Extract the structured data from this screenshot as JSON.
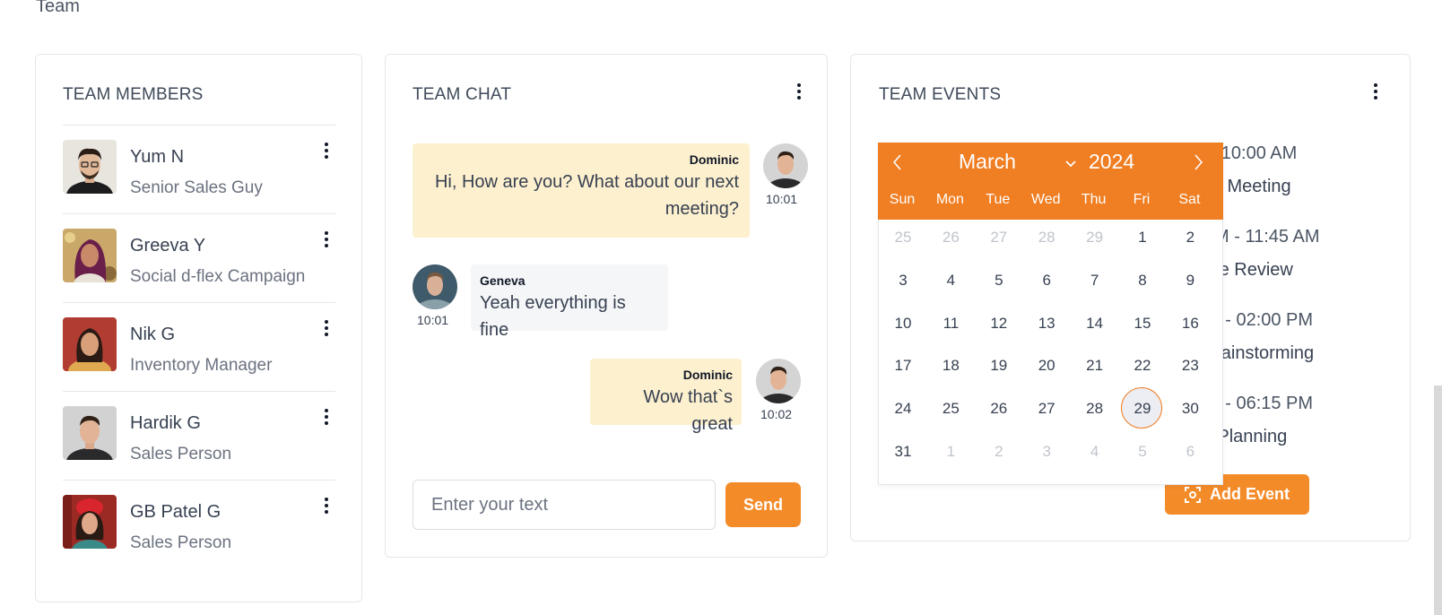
{
  "page": {
    "title": "Team"
  },
  "members": {
    "title": "TEAM MEMBERS",
    "items": [
      {
        "name": "Yum N",
        "role": "Senior Sales Guy"
      },
      {
        "name": "Greeva Y",
        "role": "Social d-flex Campaign"
      },
      {
        "name": "Nik G",
        "role": "Inventory Manager"
      },
      {
        "name": "Hardik G",
        "role": "Sales Person"
      },
      {
        "name": "GB Patel G",
        "role": "Sales Person"
      }
    ]
  },
  "chat": {
    "title": "TEAM CHAT",
    "messages": [
      {
        "author": "Dominic",
        "text": "Hi, How are you? What about our next meeting?",
        "time": "10:01"
      },
      {
        "author": "Geneva",
        "text": "Yeah everything is fine",
        "time": "10:01"
      },
      {
        "author": "Dominic",
        "text": "Wow that`s great",
        "time": "10:02"
      }
    ],
    "input_placeholder": "Enter your text",
    "send_label": "Send"
  },
  "events": {
    "title": "TEAM EVENTS",
    "items": [
      {
        "time": "AM - 10:00 AM",
        "name": "nning Meeting"
      },
      {
        "time": "30 AM - 11:45 AM",
        "name": "Scope Review"
      },
      {
        "time": "5 PM - 02:00 PM",
        "name": "24 Brainstorming"
      },
      {
        "time": "0 PM - 06:15 PM",
        "name": "eact Planning"
      }
    ],
    "add_label": "Add Event"
  },
  "calendar": {
    "month": "March",
    "year": "2024",
    "weekdays": [
      "Sun",
      "Mon",
      "Tue",
      "Wed",
      "Thu",
      "Fri",
      "Sat"
    ],
    "weeks": [
      [
        "25",
        "26",
        "27",
        "28",
        "29",
        "1",
        "2"
      ],
      [
        "3",
        "4",
        "5",
        "6",
        "7",
        "8",
        "9"
      ],
      [
        "10",
        "11",
        "12",
        "13",
        "14",
        "15",
        "16"
      ],
      [
        "17",
        "18",
        "19",
        "20",
        "21",
        "22",
        "23"
      ],
      [
        "24",
        "25",
        "26",
        "27",
        "28",
        "29",
        "30"
      ],
      [
        "31",
        "1",
        "2",
        "3",
        "4",
        "5",
        "6"
      ]
    ],
    "selected_day": "29"
  },
  "colors": {
    "accent": "#f48b29",
    "calendar_header": "#f07e22",
    "my_bubble": "#fdf0cf",
    "other_bubble": "#f5f6f8"
  }
}
